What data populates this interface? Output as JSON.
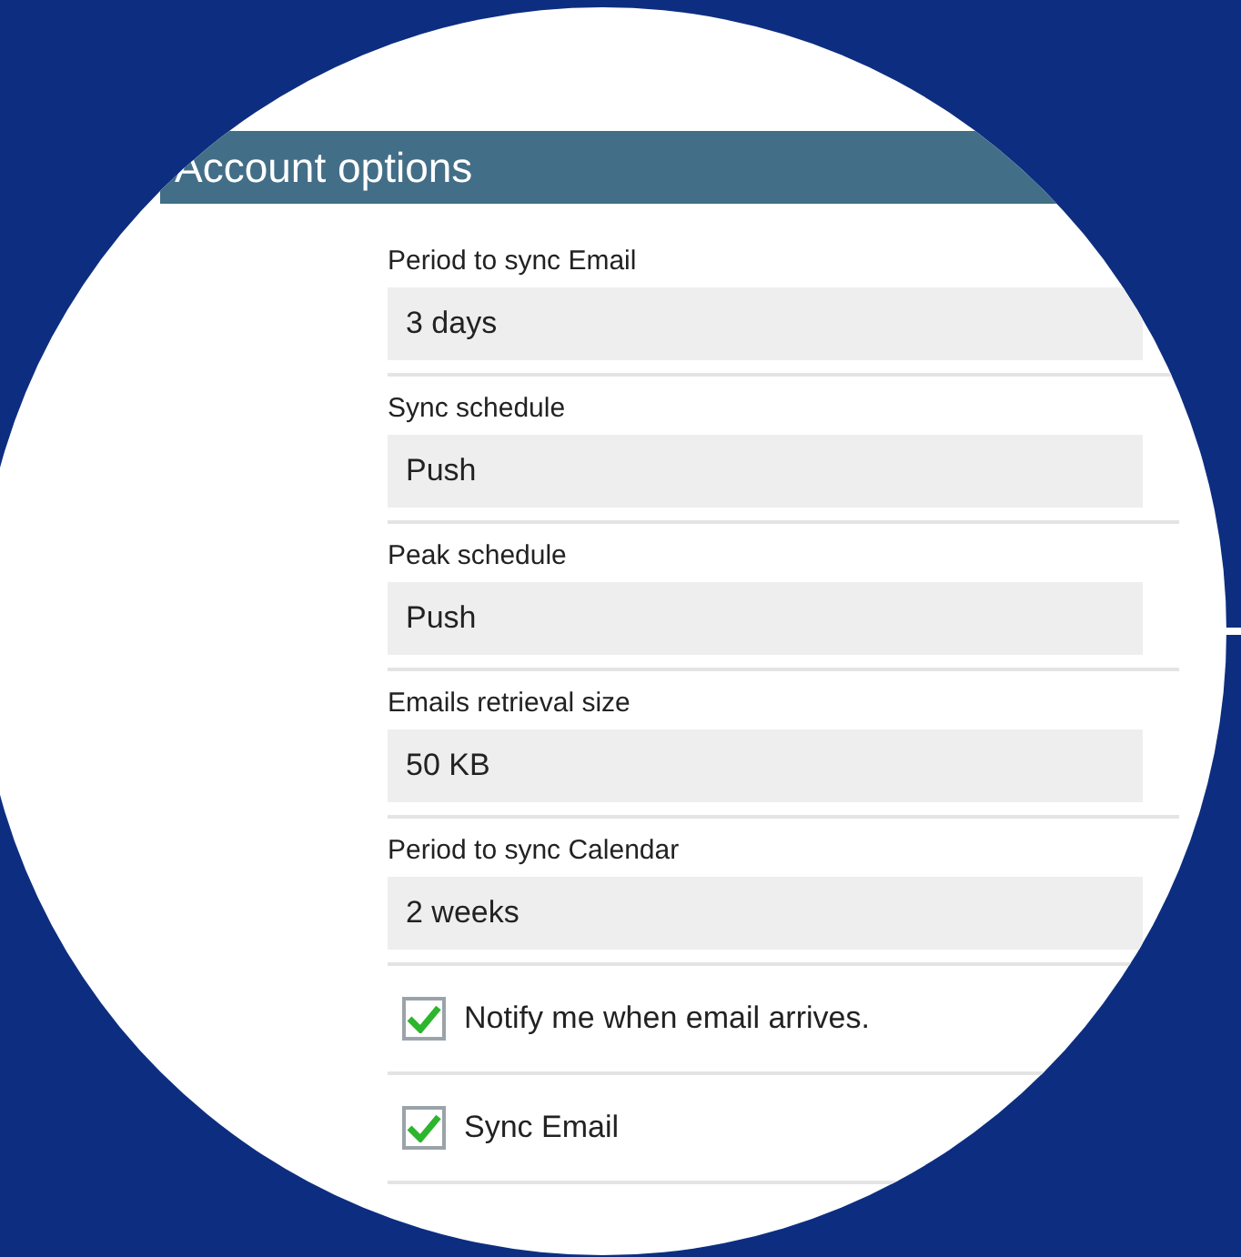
{
  "header": {
    "title": "Account options"
  },
  "settings": [
    {
      "kind": "select",
      "label": "Period to sync Email",
      "value": "3 days"
    },
    {
      "kind": "select",
      "label": "Sync schedule",
      "value": "Push"
    },
    {
      "kind": "select",
      "label": "Peak schedule",
      "value": "Push"
    },
    {
      "kind": "select",
      "label": "Emails retrieval size",
      "value": "50 KB"
    },
    {
      "kind": "select",
      "label": "Period to sync Calendar",
      "value": "2 weeks"
    },
    {
      "kind": "checkbox",
      "label": "Notify me when email arrives.",
      "checked": true
    },
    {
      "kind": "checkbox",
      "label": "Sync Email",
      "checked": true
    }
  ]
}
